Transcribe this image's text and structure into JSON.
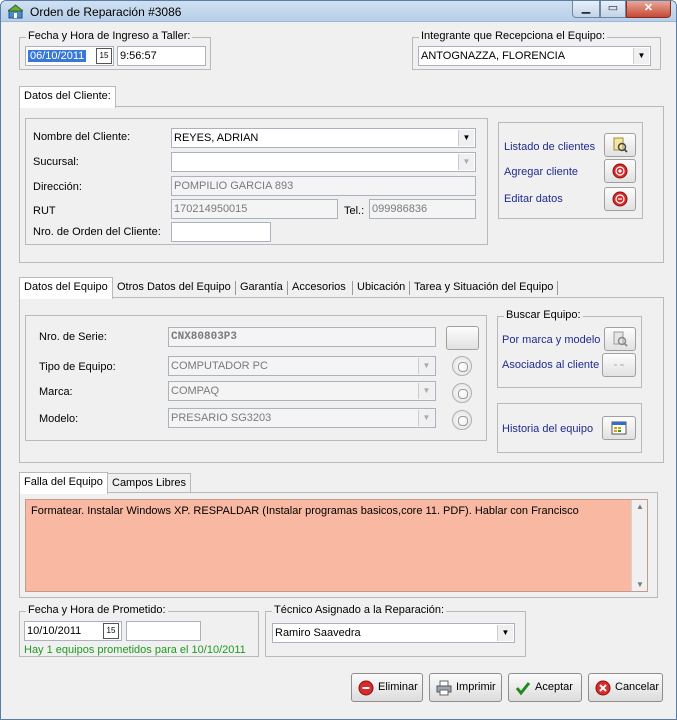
{
  "window": {
    "title": "Orden de Reparación #3086",
    "min_label": "▁",
    "max_label": "▭",
    "close_label": "✕"
  },
  "ingreso": {
    "group_title": "Fecha y Hora de Ingreso a Taller:",
    "date": "06/10/2011",
    "time": "9:56:57",
    "cal_label": "15"
  },
  "integrante": {
    "group_title": "Integrante que Recepciona el Equipo:",
    "value": "ANTOGNAZZA, FLORENCIA"
  },
  "cliente": {
    "tab_label": "Datos del Cliente:",
    "nombre_label": "Nombre del Cliente:",
    "nombre_value": "REYES, ADRIAN",
    "sucursal_label": "Sucursal:",
    "sucursal_value": "",
    "direccion_label": "Dirección:",
    "direccion_value": "POMPILIO GARCIA 893",
    "rut_label": "RUT",
    "rut_value": "170214950015",
    "tel_label": "Tel.:",
    "tel_value": "099986836",
    "orden_label": "Nro. de Orden del Cliente:",
    "orden_value": "",
    "listado_label": "Listado de clientes",
    "agregar_label": "Agregar cliente",
    "editar_label": "Editar datos"
  },
  "equipo_tabs": [
    "Datos del Equipo",
    "Otros Datos del Equipo",
    "Garantía",
    "Accesorios",
    "Ubicación",
    "Tarea y Situación del Equipo"
  ],
  "equipo": {
    "serie_label": "Nro. de Serie:",
    "serie_value": "CNX80803P3",
    "tipo_label": "Tipo de Equipo:",
    "tipo_value": "COMPUTADOR PC",
    "marca_label": "Marca:",
    "marca_value": "COMPAQ",
    "modelo_label": "Modelo:",
    "modelo_value": "PRESARIO SG3203",
    "buscar_title": "Buscar Equipo:",
    "por_marca_label": "Por marca y modelo",
    "asociados_label": "Asociados al cliente",
    "historia_label": "Historia del equipo"
  },
  "falla_tabs": [
    "Falla del Equipo",
    "Campos Libres"
  ],
  "falla": {
    "text": "Formatear. Instalar Windows XP. RESPALDAR (Instalar programas basicos,core 11. PDF). Hablar con Francisco"
  },
  "prometido": {
    "group_title": "Fecha y Hora de Prometido:",
    "date": "10/10/2011",
    "cal_label": "15",
    "time": "",
    "note": "Hay 1 equipos prometidos para el 10/10/2011"
  },
  "tecnico": {
    "group_title": "Técnico Asignado a la Reparación:",
    "value": "Ramiro Saavedra"
  },
  "actions": {
    "eliminar": "Eliminar",
    "imprimir": "Imprimir",
    "aceptar": "Aceptar",
    "cancelar": "Cancelar"
  },
  "colors": {
    "falla_bg": "#f8b8a2",
    "note_green": "#1f9a1f",
    "link_blue": "#1f2b8f"
  }
}
